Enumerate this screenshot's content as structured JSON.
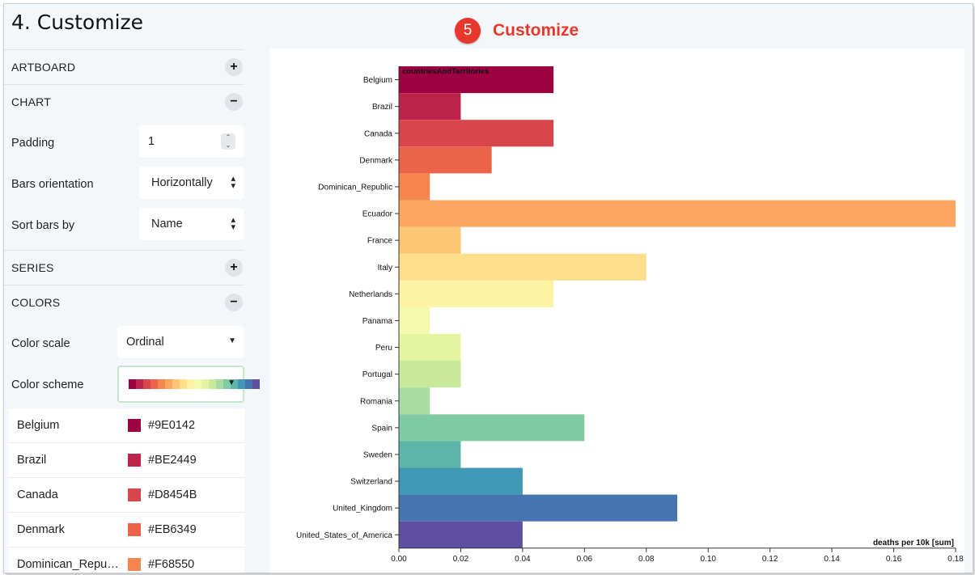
{
  "header": {
    "title": "4. Customize"
  },
  "banner": {
    "step": "5",
    "label": "Customize"
  },
  "accordion": {
    "artboard": {
      "label": "ARTBOARD",
      "toggle": "+"
    },
    "chart": {
      "label": "CHART",
      "toggle": "−"
    },
    "series": {
      "label": "SERIES",
      "toggle": "+"
    },
    "colors": {
      "label": "COLORS",
      "toggle": "−"
    }
  },
  "chart_settings": {
    "padding": {
      "label": "Padding",
      "value": "1"
    },
    "orientation": {
      "label": "Bars orientation",
      "value": "Horizontally"
    },
    "sort": {
      "label": "Sort bars by",
      "value": "Name"
    }
  },
  "color_settings": {
    "scale": {
      "label": "Color scale",
      "value": "Ordinal"
    },
    "scheme": {
      "label": "Color scheme"
    }
  },
  "scheme_swatches": [
    "#9E0142",
    "#BE2449",
    "#D8454B",
    "#EB6349",
    "#F68550",
    "#FBA762",
    "#FDC675",
    "#FDDF8B",
    "#FEF2A5",
    "#F5FAAF",
    "#E5F49E",
    "#C8E99C",
    "#A8DCA2",
    "#80CBA4",
    "#5DB6A9",
    "#4198B6",
    "#4574B1",
    "#5E4FA2"
  ],
  "color_list": [
    {
      "name": "Belgium",
      "hex": "#9E0142"
    },
    {
      "name": "Brazil",
      "hex": "#BE2449"
    },
    {
      "name": "Canada",
      "hex": "#D8454B"
    },
    {
      "name": "Denmark",
      "hex": "#EB6349"
    },
    {
      "name": "Dominican_Repub...",
      "hex": "#F68550"
    }
  ],
  "chart_data": {
    "type": "bar",
    "orientation": "horizontal",
    "title": "",
    "legend_label": "countriesAndTerritories",
    "xlabel": "deaths per 10k [sum]",
    "xlim": [
      0,
      0.18
    ],
    "xticks": [
      "0.00",
      "0.02",
      "0.04",
      "0.06",
      "0.08",
      "0.10",
      "0.12",
      "0.14",
      "0.16",
      "0.18"
    ],
    "categories": [
      "Belgium",
      "Brazil",
      "Canada",
      "Denmark",
      "Dominican_Republic",
      "Ecuador",
      "France",
      "Italy",
      "Netherlands",
      "Panama",
      "Peru",
      "Portugal",
      "Romania",
      "Spain",
      "Sweden",
      "Switzerland",
      "United_Kingdom",
      "United_States_of_America"
    ],
    "values": [
      0.05,
      0.02,
      0.05,
      0.03,
      0.01,
      0.18,
      0.02,
      0.08,
      0.05,
      0.01,
      0.02,
      0.02,
      0.01,
      0.06,
      0.02,
      0.04,
      0.09,
      0.04
    ],
    "colors": [
      "#9E0142",
      "#BE2449",
      "#D8454B",
      "#EB6349",
      "#F68550",
      "#FBA762",
      "#FDC675",
      "#FDDF8B",
      "#FEF2A5",
      "#F5FAAF",
      "#E5F49E",
      "#C8E99C",
      "#A8DCA2",
      "#80CBA4",
      "#5DB6A9",
      "#4198B6",
      "#4574B1",
      "#5E4FA2"
    ]
  }
}
